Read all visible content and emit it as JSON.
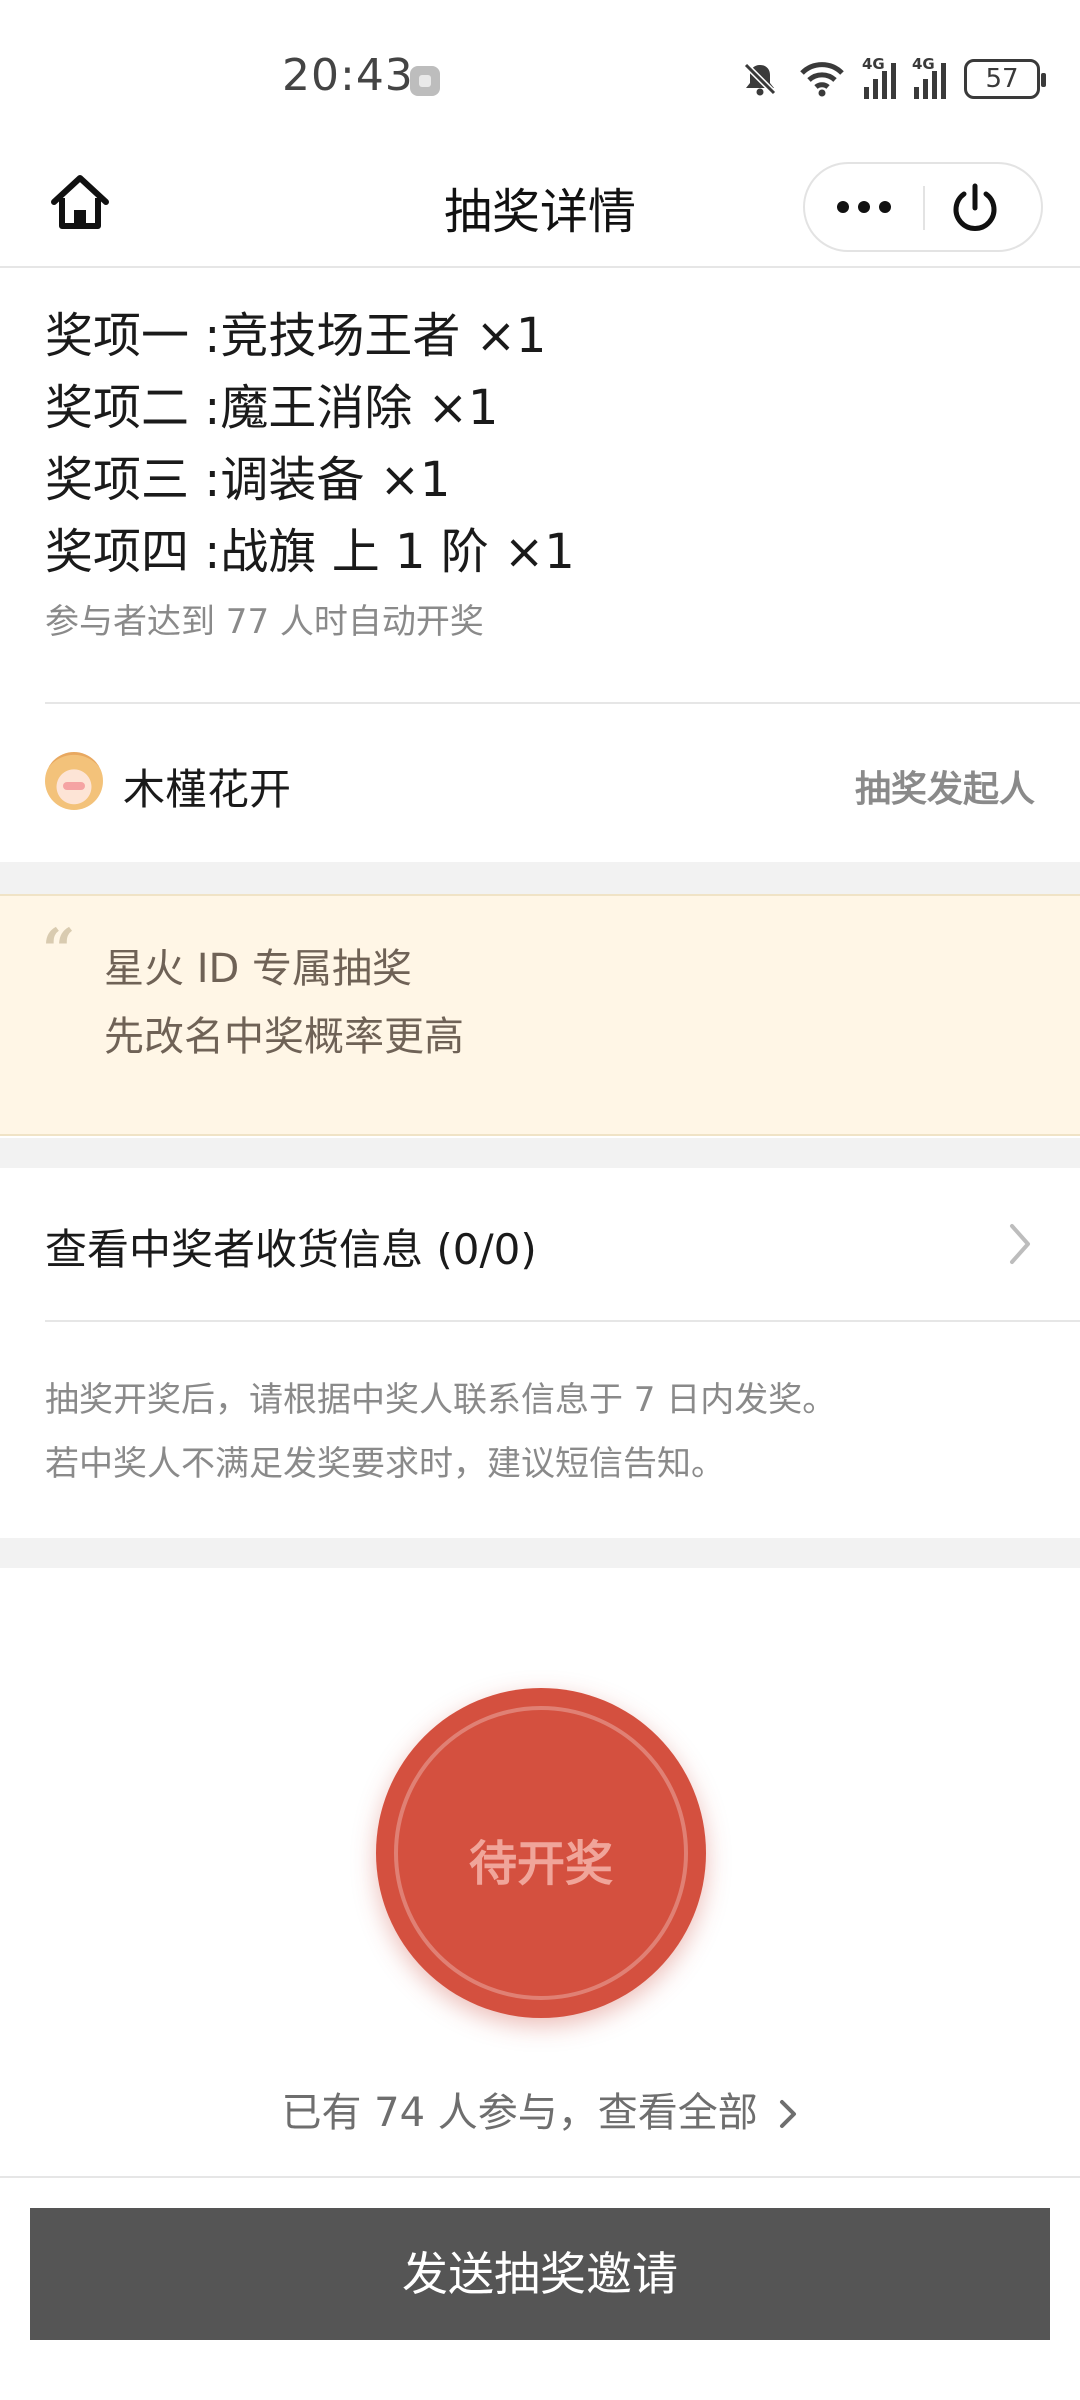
{
  "status_bar": {
    "time": "20:43",
    "icons": [
      "mute-icon",
      "wifi-icon",
      "signal-4g-icon",
      "signal-4g-icon",
      "battery-icon"
    ],
    "signal_tag": "4G",
    "battery": "57"
  },
  "nav": {
    "title": "抽奖详情",
    "home_icon": "home-icon",
    "more_icon": "more-dots-icon",
    "power_icon": "power-icon"
  },
  "prizes": [
    "奖项一 :竞技场王者 ×1",
    "奖项二 :魔王消除 ×1",
    "奖项三 :调装备 ×1",
    "奖项四 :战旗 上 1 阶 ×1"
  ],
  "draw_condition": "参与者达到 77 人时自动开奖",
  "initiator": {
    "name": "木槿花开",
    "role": "抽奖发起人"
  },
  "quote": {
    "mark": "“",
    "lines": [
      "星火 ID 专属抽奖",
      "先改名中奖概率更高"
    ]
  },
  "winner_info": {
    "label": "查看中奖者收货信息 (0/0)"
  },
  "notice": {
    "lines": [
      "抽奖开奖后，请根据中奖人联系信息于 7 日内发奖。",
      "若中奖人不满足发奖要求时，建议短信告知。"
    ]
  },
  "draw_button": {
    "label": "待开奖"
  },
  "participants": {
    "text": "已有 74 人参与，查看全部"
  },
  "invite_button": {
    "label": "发送抽奖邀请"
  },
  "colors": {
    "draw_button": "#d4503f",
    "invite_button": "#555555",
    "quote_bg": "#fff6e6"
  }
}
